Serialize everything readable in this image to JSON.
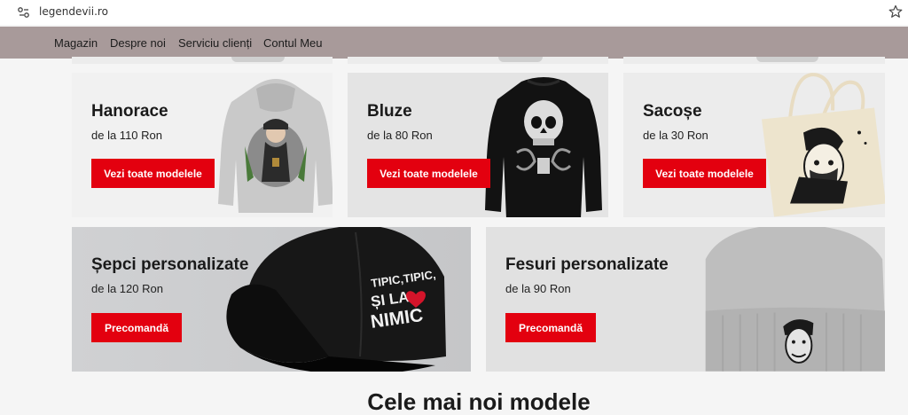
{
  "browser": {
    "url": "legendevii.ro"
  },
  "nav": {
    "items": [
      "Magazin",
      "Despre noi",
      "Serviciu clienți",
      "Contul Meu"
    ]
  },
  "categories": [
    {
      "title": "Hanorace",
      "price": "de la 110 Ron",
      "button": "Vezi toate modelele"
    },
    {
      "title": "Bluze",
      "price": "de la 80 Ron",
      "button": "Vezi toate modelele"
    },
    {
      "title": "Sacoșe",
      "price": "de la 30 Ron",
      "button": "Vezi toate modelele"
    },
    {
      "title": "Șepci personalizate",
      "price": "de la 120 Ron",
      "button": "Precomandă"
    },
    {
      "title": "Fesuri personalizate",
      "price": "de la 90 Ron",
      "button": "Precomandă"
    }
  ],
  "cap_print": {
    "line1": "TIPIC,TIPIC,",
    "line2": "ȘI LA",
    "line3": "NIMIC"
  },
  "section": {
    "title": "Cele mai noi modele"
  },
  "colors": {
    "accent": "#e3000f",
    "navbar": "#a89a9a"
  }
}
